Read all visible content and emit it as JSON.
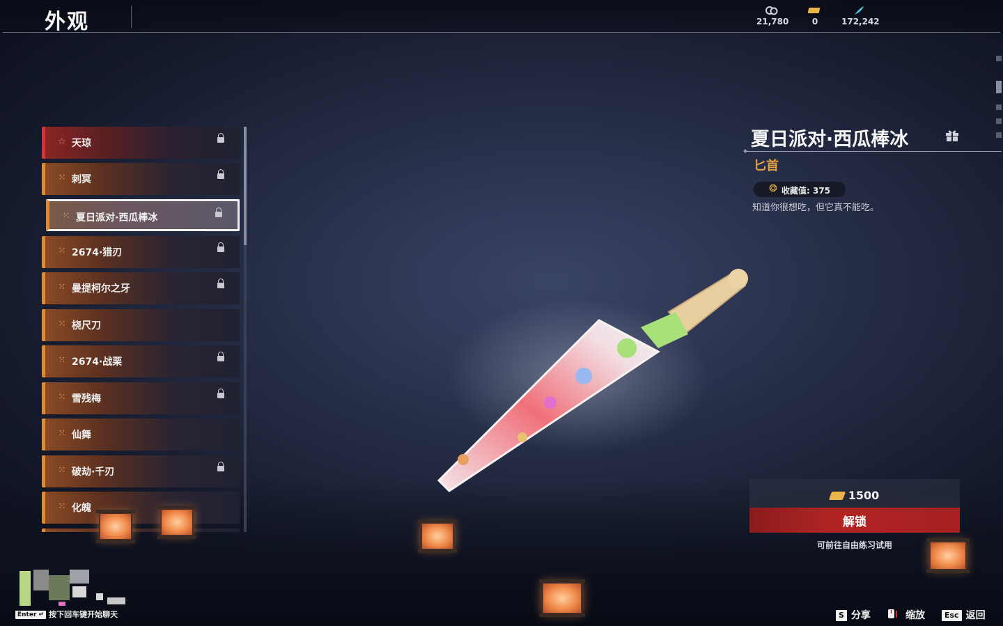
{
  "header": {
    "title": "外观",
    "currencies": [
      {
        "icon": "coin-stack-icon",
        "value": "21,780"
      },
      {
        "icon": "ticket-icon",
        "value": "0"
      },
      {
        "icon": "feather-icon",
        "value": "172,242"
      }
    ]
  },
  "list": {
    "items": [
      {
        "label": "天琼",
        "icon": "star-icon",
        "locked": true,
        "rarity": "red"
      },
      {
        "label": "刺冥",
        "icon": "knot-icon",
        "locked": true,
        "rarity": "gold"
      },
      {
        "label": "夏日派对·西瓜棒冰",
        "icon": "knot-icon",
        "locked": true,
        "rarity": "gold",
        "selected": true
      },
      {
        "label": "2674·猎刃",
        "icon": "knot-icon",
        "locked": true,
        "rarity": "gold"
      },
      {
        "label": "曼提柯尔之牙",
        "icon": "knot-icon",
        "locked": true,
        "rarity": "gold"
      },
      {
        "label": "桡尺刀",
        "icon": "knot-icon",
        "locked": false,
        "rarity": "gold"
      },
      {
        "label": "2674·战栗",
        "icon": "knot-icon",
        "locked": true,
        "rarity": "gold"
      },
      {
        "label": "雪残梅",
        "icon": "knot-icon",
        "locked": true,
        "rarity": "gold"
      },
      {
        "label": "仙舞",
        "icon": "knot-icon",
        "locked": false,
        "rarity": "gold"
      },
      {
        "label": "破劫·千刃",
        "icon": "knot-icon",
        "locked": true,
        "rarity": "gold"
      },
      {
        "label": "化魄",
        "icon": "knot-icon",
        "locked": false,
        "rarity": "gold"
      }
    ]
  },
  "detail": {
    "name": "夏日派对·西瓜棒冰",
    "type": "匕首",
    "collection_label": "收藏值: 375",
    "description": "知道你很想吃，但它真不能吃。",
    "price": "1500",
    "unlock_label": "解锁",
    "trial_hint": "可前往自由练习试用"
  },
  "footer": {
    "chat_key": "Enter",
    "chat_hint": "按下回车键开始聊天",
    "actions": [
      {
        "key": "S",
        "label": "分享"
      },
      {
        "key": "",
        "label": "缩放",
        "icon": "mouse-icon"
      },
      {
        "key": "Esc",
        "label": "返回"
      }
    ]
  },
  "colors": {
    "accent_gold": "#e08a35",
    "accent_red": "#d0353a",
    "unlock_button": "#b22424",
    "type_text": "#e0a040"
  }
}
